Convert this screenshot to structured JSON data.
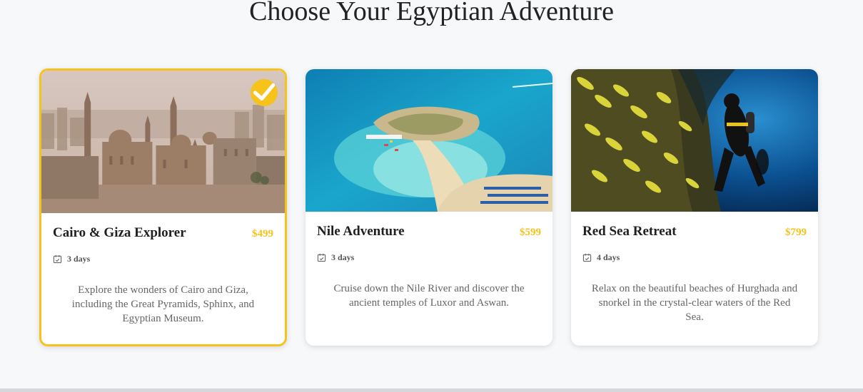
{
  "page": {
    "title": "Choose Your Egyptian Adventure"
  },
  "tours": [
    {
      "title": "Cairo & Giza Explorer",
      "price": "$499",
      "duration": "3 days",
      "description": "Explore the wonders of Cairo and Giza, including the Great Pyramids, Sphinx, and Egyptian Museum.",
      "selected": true,
      "image": "cairo-skyline"
    },
    {
      "title": "Nile Adventure",
      "price": "$599",
      "duration": "3 days",
      "description": "Cruise down the Nile River and discover the ancient temples of Luxor and Aswan.",
      "selected": false,
      "image": "island-beach"
    },
    {
      "title": "Red Sea Retreat",
      "price": "$799",
      "duration": "4 days",
      "description": "Relax on the beautiful beaches of Hurghada and snorkel in the crystal-clear waters of the Red Sea.",
      "selected": false,
      "image": "diver-reef"
    }
  ],
  "icons": {
    "selected_badge": "check-icon",
    "duration": "calendar-icon"
  },
  "colors": {
    "accent": "#f6c21c",
    "background": "#f7f8fa",
    "title": "#222222",
    "text_muted": "#666666"
  }
}
